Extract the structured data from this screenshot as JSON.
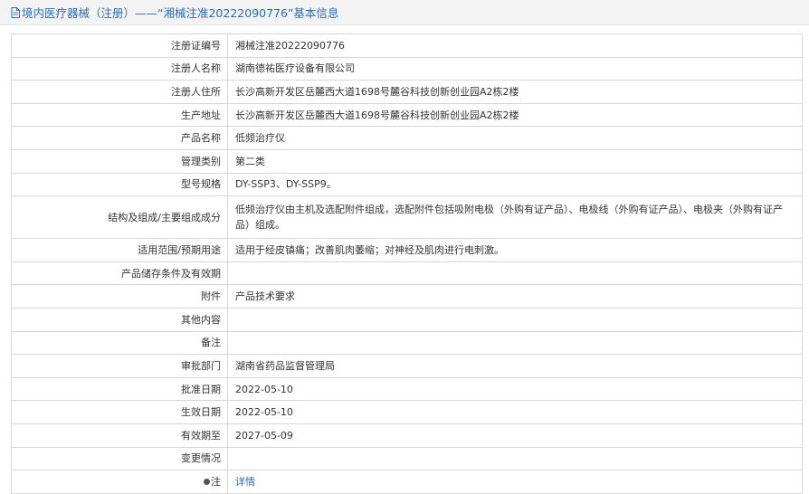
{
  "header": {
    "title": "境内医疗器械（注册）——“湘械注准20222090776”基本信息",
    "icon": "document-icon",
    "color": "#2b6cb5"
  },
  "rows": [
    {
      "label": "注册证编号",
      "value": "湘械注准20222090776"
    },
    {
      "label": "注册人名称",
      "value": "湖南德祐医疗设备有限公司"
    },
    {
      "label": "注册人住所",
      "value": "长沙高新开发区岳麓西大道1698号麓谷科技创新创业园A2栋2楼"
    },
    {
      "label": "生产地址",
      "value": "长沙高新开发区岳麓西大道1698号麓谷科技创新创业园A2栋2楼"
    },
    {
      "label": "产品名称",
      "value": "低频治疗仪"
    },
    {
      "label": "管理类别",
      "value": "第二类"
    },
    {
      "label": "型号规格",
      "value": "DY-SSP3、DY-SSP9。"
    },
    {
      "label": "结构及组成/主要组成成分",
      "value": "低频治疗仪由主机及选配附件组成，选配附件包括吸附电极（外购有证产品）、电极线（外购有证产品）、电极夹（外购有证产品）组成。"
    },
    {
      "label": "适用范围/预期用途",
      "value": "适用于经皮镇痛；改善肌肉萎缩；对神经及肌肉进行电刺激。"
    },
    {
      "label": "产品储存条件及有效期",
      "value": ""
    },
    {
      "label": "附件",
      "value": "产品技术要求"
    },
    {
      "label": "其他内容",
      "value": ""
    },
    {
      "label": "备注",
      "value": ""
    },
    {
      "label": "审批部门",
      "value": "湖南省药品监督管理局"
    },
    {
      "label": "批准日期",
      "value": "2022-05-10"
    },
    {
      "label": "生效日期",
      "value": "2022-05-10"
    },
    {
      "label": "有效期至",
      "value": "2027-05-09"
    },
    {
      "label": "变更情况",
      "value": ""
    }
  ],
  "note_row": {
    "icon": "bullet-icon",
    "label": "注",
    "link_text": "详情"
  },
  "colors": {
    "link": "#2b6cb5",
    "border": "#d7d7d7",
    "header_bg": "#f3f3f3"
  }
}
